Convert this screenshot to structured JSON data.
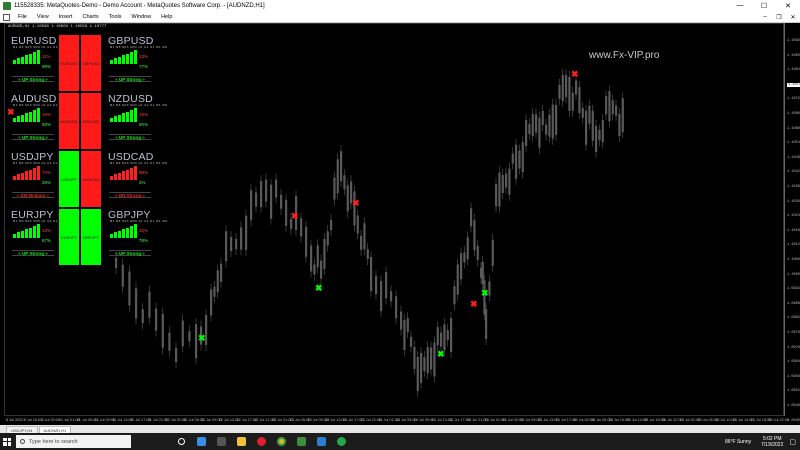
{
  "window": {
    "title": "115528335: MetaQuotes-Demo - Demo Account - MetaQuotes Software Corp. - [AUDNZD,H1]",
    "controls": [
      "—",
      "☐",
      "✕"
    ]
  },
  "menu": [
    "File",
    "View",
    "Insert",
    "Charts",
    "Tools",
    "Window",
    "Help"
  ],
  "chart": {
    "label": "AUDNZD,H1 1.10598 1.10603 1.10558 1.10777",
    "watermark": "www.Fx-VIP.pro",
    "price_labels": [
      "1.10960",
      "1.10900",
      "1.10840",
      "1.10777",
      "1.10720",
      "1.10660",
      "1.10600",
      "1.10540",
      "1.10480",
      "1.10420",
      "1.10360",
      "1.10300",
      "1.10240",
      "1.10180",
      "1.10120",
      "1.10060",
      "1.10000",
      "1.09940",
      "1.09880",
      "1.09820",
      "1.09760",
      "1.09700",
      "1.09640",
      "1.09580",
      "1.09520",
      "1.09460",
      "1.09400"
    ],
    "current_price": "1.10777",
    "time_labels": [
      "8 Jul 2022",
      "8 Jul 16:00",
      "8 Jul 20:00",
      "11 Jul 01:00",
      "11 Jul 05:00",
      "11 Jul 09:00",
      "11 Jul 13:00",
      "11 Jul 17:00",
      "11 Jul 21:00",
      "12 Jul 01:00",
      "12 Jul 05:00",
      "12 Jul 09:00",
      "12 Jul 13:00",
      "12 Jul 17:00",
      "12 Jul 21:00",
      "13 Jul 01:00",
      "13 Jul 05:00",
      "13 Jul 09:00",
      "13 Jul 13:00",
      "13 Jul 17:00",
      "13 Jul 21:00",
      "14 Jul 01:00",
      "14 Jul 05:00",
      "14 Jul 09:00",
      "14 Jul 13:00",
      "14 Jul 17:00",
      "14 Jul 21:00",
      "15 Jul 01:00",
      "15 Jul 05:00",
      "15 Jul 09:00",
      "15 Jul 13:00",
      "15 Jul 17:00",
      "18 Jul 00:00",
      "18 Jul 06:00",
      "18 Jul 10:00",
      "18 Jul 14:00",
      "18 Jul 18:00",
      "18 Jul 22:00",
      "19 Jul 02:00",
      "19 Jul 06:00",
      "19 Jul 10:00",
      "19 Jul 14:00",
      "19 Jul 18:00",
      "19 Jul 22:00"
    ],
    "colors": {
      "up": "#00ff00",
      "down": "#ff2020",
      "candle": "#5a5a5a"
    }
  },
  "panel": {
    "timeframes": "M1 M5 M15 M30 H1 H4 D1 W1 MN",
    "pairs": [
      {
        "name": "EURUSD",
        "pct1": "11%",
        "pct2": "89%",
        "strength": "« UP Strong »",
        "trend": "up"
      },
      {
        "name": "GBPUSD",
        "pct1": "23%",
        "pct2": "77%",
        "strength": "« UP Strong »",
        "trend": "up"
      },
      {
        "name": "AUDUSD",
        "pct1": "10%",
        "pct2": "90%",
        "strength": "« UP Strong »",
        "trend": "up"
      },
      {
        "name": "NZDUSD",
        "pct1": "10%",
        "pct2": "90%",
        "strength": "« UP Strong »",
        "trend": "up"
      },
      {
        "name": "USDJPY",
        "pct1": "74%",
        "pct2": "26%",
        "strength": "« DN Medium »",
        "trend": "down"
      },
      {
        "name": "USDCAD",
        "pct1": "98%",
        "pct2": "2%",
        "strength": "« DN Strong »",
        "trend": "down"
      },
      {
        "name": "EURJPY",
        "pct1": "13%",
        "pct2": "87%",
        "strength": "« UP Strong »",
        "trend": "up"
      },
      {
        "name": "GBPJPY",
        "pct1": "22%",
        "pct2": "78%",
        "strength": "« UP Strong »",
        "trend": "up"
      }
    ],
    "squares": [
      {
        "label": "EURUSD",
        "color": "#ff1a1a"
      },
      {
        "label": "GBPUSD",
        "color": "#ff1a1a"
      },
      {
        "label": "AUDUSD",
        "color": "#ff1a1a"
      },
      {
        "label": "NZDUSD",
        "color": "#ff1a1a"
      },
      {
        "label": "USDJPY",
        "color": "#00ff00"
      },
      {
        "label": "USDCAD",
        "color": "#ff1a1a"
      },
      {
        "label": "EURJPY",
        "color": "#00ff00"
      },
      {
        "label": "GBPJPY",
        "color": "#00ff00"
      }
    ]
  },
  "signals": [
    {
      "type": "sell",
      "symbol": "✖"
    },
    {
      "type": "sell",
      "symbol": "✖"
    },
    {
      "type": "sell",
      "symbol": "✖"
    },
    {
      "type": "sell",
      "symbol": "✖"
    },
    {
      "type": "sell",
      "symbol": "✖"
    },
    {
      "type": "buy",
      "symbol": "✖"
    },
    {
      "type": "buy",
      "symbol": "✖"
    },
    {
      "type": "buy",
      "symbol": "✖"
    },
    {
      "type": "buy",
      "symbol": "✖"
    }
  ],
  "tabs": [
    "USDJPY,H4",
    "AUDNZD,H1"
  ],
  "taskbar": {
    "search_placeholder": "Type here to search",
    "weather": "86°F  Sunny",
    "time": "5:02 PM",
    "date": "7/19/2022"
  }
}
